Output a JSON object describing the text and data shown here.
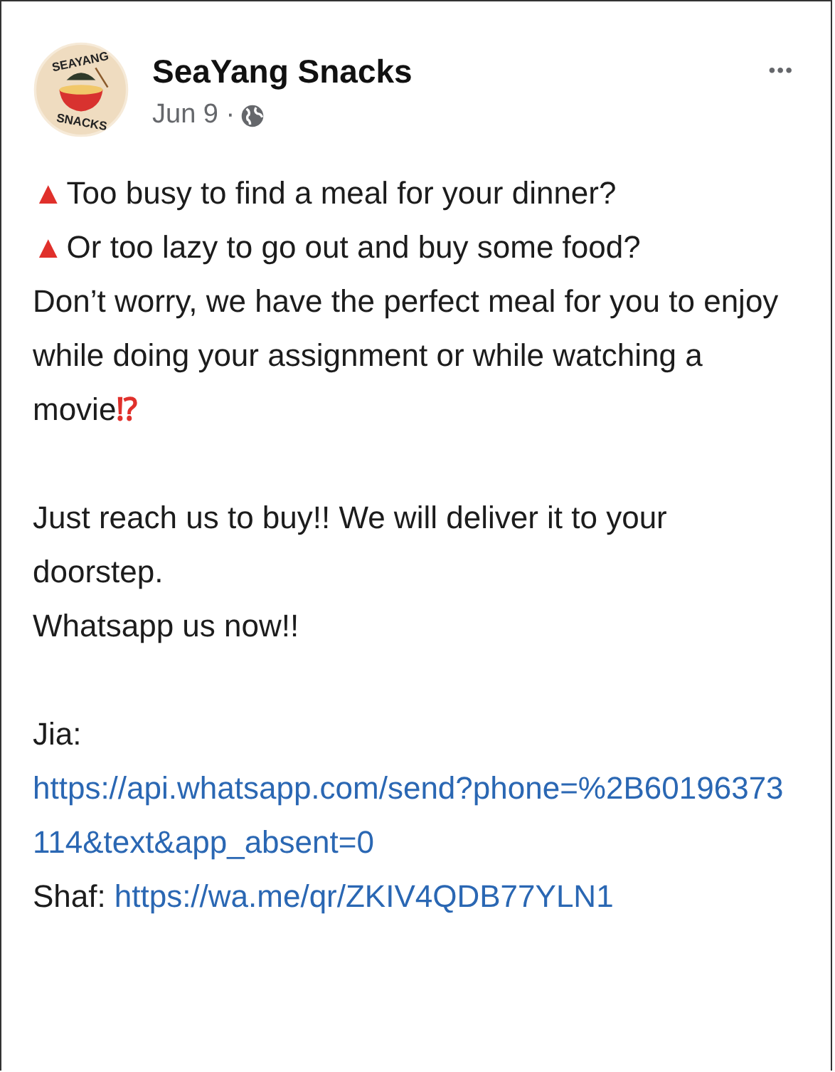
{
  "post": {
    "author": "SeaYang Snacks",
    "date": "Jun 9 ·",
    "avatar": {
      "top_text": "SEAYANG",
      "bottom_text": "SNACKS"
    },
    "menu": "•••",
    "body": [
      {
        "kind": "bullet",
        "icon": "▲",
        "text": "Too busy to find a meal for your dinner?"
      },
      {
        "kind": "bullet",
        "icon": "▲",
        "text": "Or too lazy to go out and buy some food?"
      },
      {
        "kind": "text",
        "text": "Don’t worry, we have the perfect meal for you to enjoy while doing your assignment or while watching a movie",
        "end_icon": "⁉"
      },
      {
        "kind": "blank"
      },
      {
        "kind": "text",
        "text": "Just reach us to buy!! We will deliver it to your doorstep."
      },
      {
        "kind": "text",
        "text": "Whatsapp us now!!"
      },
      {
        "kind": "blank"
      },
      {
        "kind": "text",
        "text": "Jia:"
      },
      {
        "kind": "link",
        "text": "https://api.whatsapp.com/send?phone=%2B60196373114&text&app_absent=0"
      },
      {
        "kind": "labeled_link",
        "label": "Shaf:",
        "text": "https://wa.me/qr/ZKIV4QDB77YLN1"
      }
    ]
  }
}
